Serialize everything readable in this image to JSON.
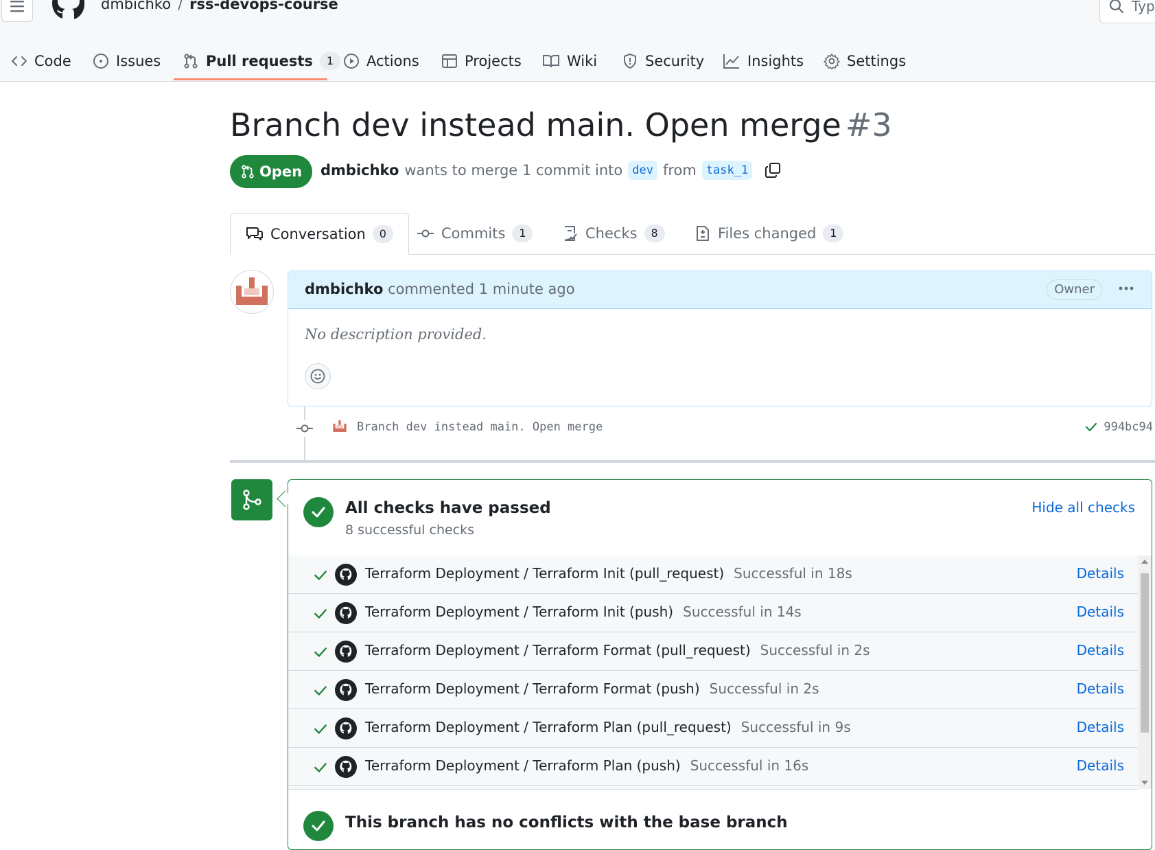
{
  "header": {
    "owner": "dmbichko",
    "separator": "/",
    "repo": "rss-devops-course",
    "search_placeholder": "Typ"
  },
  "repo_nav": [
    {
      "label": "Code",
      "icon": "code-icon"
    },
    {
      "label": "Issues",
      "icon": "issue-icon"
    },
    {
      "label": "Pull requests",
      "icon": "pull-request-icon",
      "count": "1",
      "active": true
    },
    {
      "label": "Actions",
      "icon": "play-icon"
    },
    {
      "label": "Projects",
      "icon": "table-icon"
    },
    {
      "label": "Wiki",
      "icon": "book-icon"
    },
    {
      "label": "Security",
      "icon": "shield-icon"
    },
    {
      "label": "Insights",
      "icon": "graph-icon"
    },
    {
      "label": "Settings",
      "icon": "gear-icon"
    }
  ],
  "pr": {
    "title": "Branch dev instead main. Open merge",
    "number": "#3",
    "state": "Open",
    "author": "dmbichko",
    "merge_text": "wants to merge 1 commit into",
    "base_branch": "dev",
    "from_text": "from",
    "head_branch": "task_1"
  },
  "pr_tabs": [
    {
      "label": "Conversation",
      "count": "0",
      "icon": "comment-discussion-icon",
      "active": true
    },
    {
      "label": "Commits",
      "count": "1",
      "icon": "commit-icon"
    },
    {
      "label": "Checks",
      "count": "8",
      "icon": "checklist-icon"
    },
    {
      "label": "Files changed",
      "count": "1",
      "icon": "file-diff-icon"
    }
  ],
  "comment": {
    "author": "dmbichko",
    "action": "commented 1 minute ago",
    "badge": "Owner",
    "body": "No description provided."
  },
  "commit": {
    "message": "Branch dev instead main. Open merge",
    "sha": "994bc94"
  },
  "merge_box": {
    "title": "All checks have passed",
    "subtitle": "8 successful checks",
    "hide_link": "Hide all checks",
    "checks": [
      {
        "name": "Terraform Deployment / Terraform Init (pull_request)",
        "duration": "Successful in 18s",
        "link": "Details"
      },
      {
        "name": "Terraform Deployment / Terraform Init (push)",
        "duration": "Successful in 14s",
        "link": "Details"
      },
      {
        "name": "Terraform Deployment / Terraform Format (pull_request)",
        "duration": "Successful in 2s",
        "link": "Details"
      },
      {
        "name": "Terraform Deployment / Terraform Format (push)",
        "duration": "Successful in 2s",
        "link": "Details"
      },
      {
        "name": "Terraform Deployment / Terraform Plan (pull_request)",
        "duration": "Successful in 9s",
        "link": "Details"
      },
      {
        "name": "Terraform Deployment / Terraform Plan (push)",
        "duration": "Successful in 16s",
        "link": "Details"
      }
    ],
    "no_conflicts_title": "This branch has no conflicts with the base branch"
  },
  "colors": {
    "success": "#1f883d",
    "link": "#0969da",
    "nav_underline": "#fd8c73",
    "comment_header": "#ddf4ff"
  }
}
